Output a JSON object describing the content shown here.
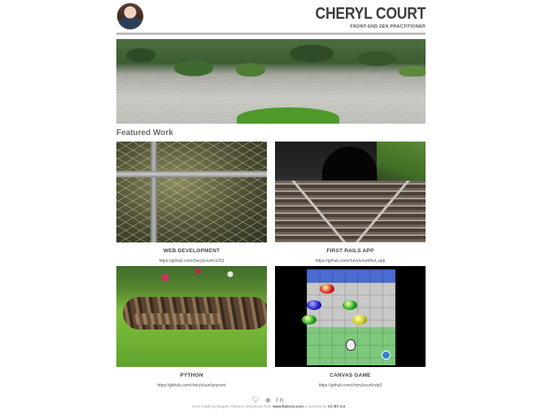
{
  "header": {
    "name": "CHERYL COURT",
    "tagline": "FRONT-END ZEN PRACTITIONER"
  },
  "featured": {
    "title": "Featured Work",
    "items": [
      {
        "title": "WEB DEVELOPMENT",
        "url": "https://github.com/cherylcourt/cs253"
      },
      {
        "title": "FIRST RAILS APP",
        "url": "https://github.com/cherylcourt/first_app"
      },
      {
        "title": "PYTHON",
        "url": "https://github.com/cherylcourt/anycont"
      },
      {
        "title": "CANVAS GAME",
        "url": "https://github.com/cherylcourt/ndp3"
      }
    ]
  },
  "footer": {
    "social_icons": [
      "twitter-icon",
      "github-icon",
      "linkedin-icon"
    ],
    "credit_prefix": "Icons made by Elegant Themes, Simpleicon from",
    "credit_site": "www.flaticon.com",
    "credit_mid": "is licensed by",
    "credit_license": "CC BY 3.0"
  }
}
